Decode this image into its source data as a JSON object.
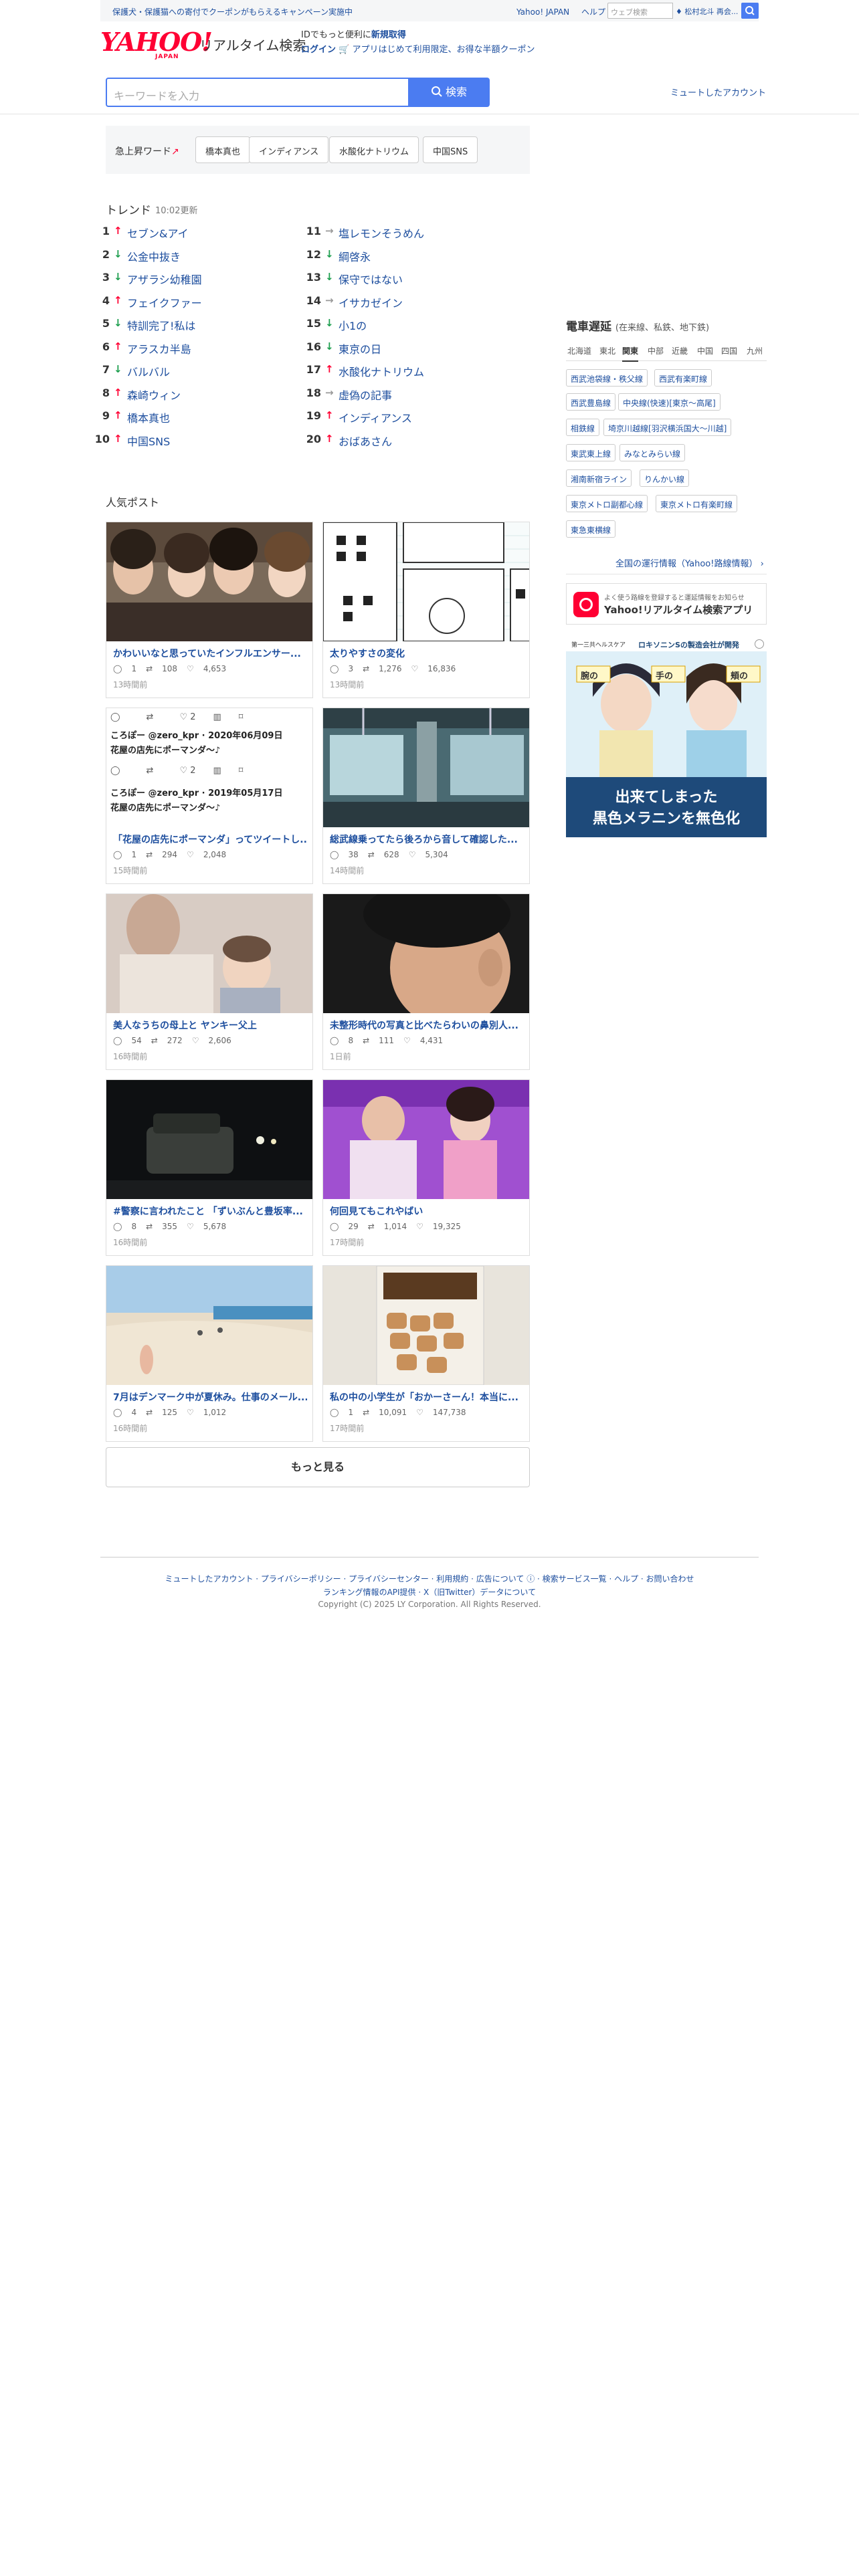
{
  "header": {
    "promo": "保護犬・保護猫への寄付でクーポンがもらえるキャンペーン実施中",
    "yahoo_japan_link": "Yahoo! JAPAN",
    "help_link": "ヘルプ",
    "web_search_placeholder": "ウェブ検索",
    "web_search_hint": "♦ 松村北斗 再会...",
    "logo_text": "YAHOO!",
    "logo_japan": "JAPAN",
    "service_name": "リアルタイム検索",
    "login_line1_prefix": "IDでもっと便利に",
    "login_line1_link": "新規取得",
    "login_line2_link": "ログイン",
    "login_line2_text": "🛒 アプリはじめて利用限定、お得な半額クーポン"
  },
  "search": {
    "placeholder": "キーワードを入力",
    "button_label": "検索",
    "muted_accounts_link": "ミュートしたアカウント"
  },
  "rising": {
    "label": "急上昇ワード",
    "chips": [
      "橋本真也",
      "インディアンス",
      "水酸化ナトリウム",
      "中国SNS"
    ]
  },
  "trend": {
    "title": "トレンド",
    "updated": "10:02更新",
    "items": [
      {
        "rank": "1",
        "dir": "up",
        "kw": "セブン&アイ"
      },
      {
        "rank": "2",
        "dir": "down",
        "kw": "公金中抜き"
      },
      {
        "rank": "3",
        "dir": "down",
        "kw": "アザラシ幼稚園"
      },
      {
        "rank": "4",
        "dir": "up",
        "kw": "フェイクファー"
      },
      {
        "rank": "5",
        "dir": "down",
        "kw": "特訓完了!私は"
      },
      {
        "rank": "6",
        "dir": "up",
        "kw": "アラスカ半島"
      },
      {
        "rank": "7",
        "dir": "down",
        "kw": "バルバル"
      },
      {
        "rank": "8",
        "dir": "up",
        "kw": "森崎ウィン"
      },
      {
        "rank": "9",
        "dir": "up",
        "kw": "橋本真也"
      },
      {
        "rank": "10",
        "dir": "up",
        "kw": "中国SNS"
      },
      {
        "rank": "11",
        "dir": "flat",
        "kw": "塩レモンそうめん"
      },
      {
        "rank": "12",
        "dir": "down",
        "kw": "綱啓永"
      },
      {
        "rank": "13",
        "dir": "down",
        "kw": "保守ではない"
      },
      {
        "rank": "14",
        "dir": "flat",
        "kw": "イサカゼイン"
      },
      {
        "rank": "15",
        "dir": "down",
        "kw": "小1の"
      },
      {
        "rank": "16",
        "dir": "down",
        "kw": "東京の日"
      },
      {
        "rank": "17",
        "dir": "up",
        "kw": "水酸化ナトリウム"
      },
      {
        "rank": "18",
        "dir": "flat",
        "kw": "虚偽の記事"
      },
      {
        "rank": "19",
        "dir": "up",
        "kw": "インディアンス"
      },
      {
        "rank": "20",
        "dir": "up",
        "kw": "おばあさん"
      }
    ]
  },
  "popular": {
    "title": "人気ポスト",
    "cards": [
      {
        "title": "かわいいなと思っていたインフルエンサー...",
        "replies": "1",
        "reposts": "108",
        "likes": "4,653",
        "ago": "13時間前"
      },
      {
        "title": "太りやすさの変化",
        "replies": "3",
        "reposts": "1,276",
        "likes": "16,836",
        "ago": "13時間前"
      },
      {
        "title": "「花屋の店先にポーマンダ」ってツイートし...",
        "replies": "1",
        "reposts": "294",
        "likes": "2,048",
        "ago": "15時間前"
      },
      {
        "title": "総武線乗ってたら後ろから音して確認した...",
        "replies": "38",
        "reposts": "628",
        "likes": "5,304",
        "ago": "14時間前"
      },
      {
        "title": "美人なうちの母上と ヤンキー父上",
        "replies": "54",
        "reposts": "272",
        "likes": "2,606",
        "ago": "16時間前"
      },
      {
        "title": "未整形時代の写真と比べたらわいの鼻別人...",
        "replies": "8",
        "reposts": "111",
        "likes": "4,431",
        "ago": "1日前"
      },
      {
        "title": "#警察に言われたこと 「ずいぶんと豊坂率...",
        "replies": "8",
        "reposts": "355",
        "likes": "5,678",
        "ago": "16時間前"
      },
      {
        "title": "何回見てもこれやばい",
        "replies": "29",
        "reposts": "1,014",
        "likes": "19,325",
        "ago": "17時間前"
      },
      {
        "title": "7月はデンマーク中が夏休み。仕事のメール...",
        "replies": "4",
        "reposts": "125",
        "likes": "1,012",
        "ago": "16時間前"
      },
      {
        "title": "私の中の小学生が「おかーさーん！本当に...",
        "replies": "1",
        "reposts": "10,091",
        "likes": "147,738",
        "ago": "17時間前"
      }
    ],
    "tweet_author1": "ころぽー @zero_kpr · 2020年06月09日",
    "tweet_text1": "花屋の店先にポーマンダ〜♪",
    "tweet_author2": "ころぽー @zero_kpr · 2019年05月17日",
    "tweet_text2": "花屋の店先にポーマンダ〜♪",
    "tweet_likes": "2",
    "more_button": "もっと見る"
  },
  "sidebar": {
    "train_title": "電車遅延",
    "train_sub": "(在来線、私鉄、地下鉄)",
    "regions": [
      "北海道",
      "東北",
      "関東",
      "中部",
      "近畿",
      "中国",
      "四国",
      "九州"
    ],
    "active_region": "関東",
    "lines": [
      "西武池袋線・秩父線",
      "西武有楽町線",
      "西武豊島線",
      "中央線(快速)[東京〜高尾]",
      "相鉄線",
      "埼京川越線[羽沢横浜国大〜川越]",
      "東武東上線",
      "みなとみらい線",
      "湘南新宿ライン",
      "りんかい線",
      "東京メトロ副都心線",
      "東京メトロ有楽町線",
      "東急東横線"
    ],
    "all_info_link": "全国の運行情報（Yahoo!路線情報）",
    "app_banner_small": "よく使う路線を登録すると運延情報をお知らせ",
    "app_banner_big": "Yahoo!リアルタイム検索アプリ",
    "ad_brand": "第一三共ヘルスケア",
    "ad_product": "ロキソニンSの製造会社が開発",
    "ad_tags": [
      "腕の",
      "手の",
      "頬の"
    ],
    "ad_headline1": "出来てしまった",
    "ad_headline2": "黒色メラニンを無色化"
  },
  "footer": {
    "links1": "ミュートしたアカウント · プライバシーポリシー · プライバシーセンター · 利用規約 · 広告について ⓘ · 検索サービス一覧 · ヘルプ · お問い合わせ",
    "links2": "ランキング情報のAPI提供 · X（旧Twitter）データについて",
    "copyright": "Copyright (C) 2025 LY Corporation. All Rights Reserved."
  },
  "colors": {
    "accent": "#4b7cf1",
    "link": "#1d4e9e",
    "up": "#ff0033",
    "down": "#1d9e4e",
    "flat": "#999999"
  }
}
